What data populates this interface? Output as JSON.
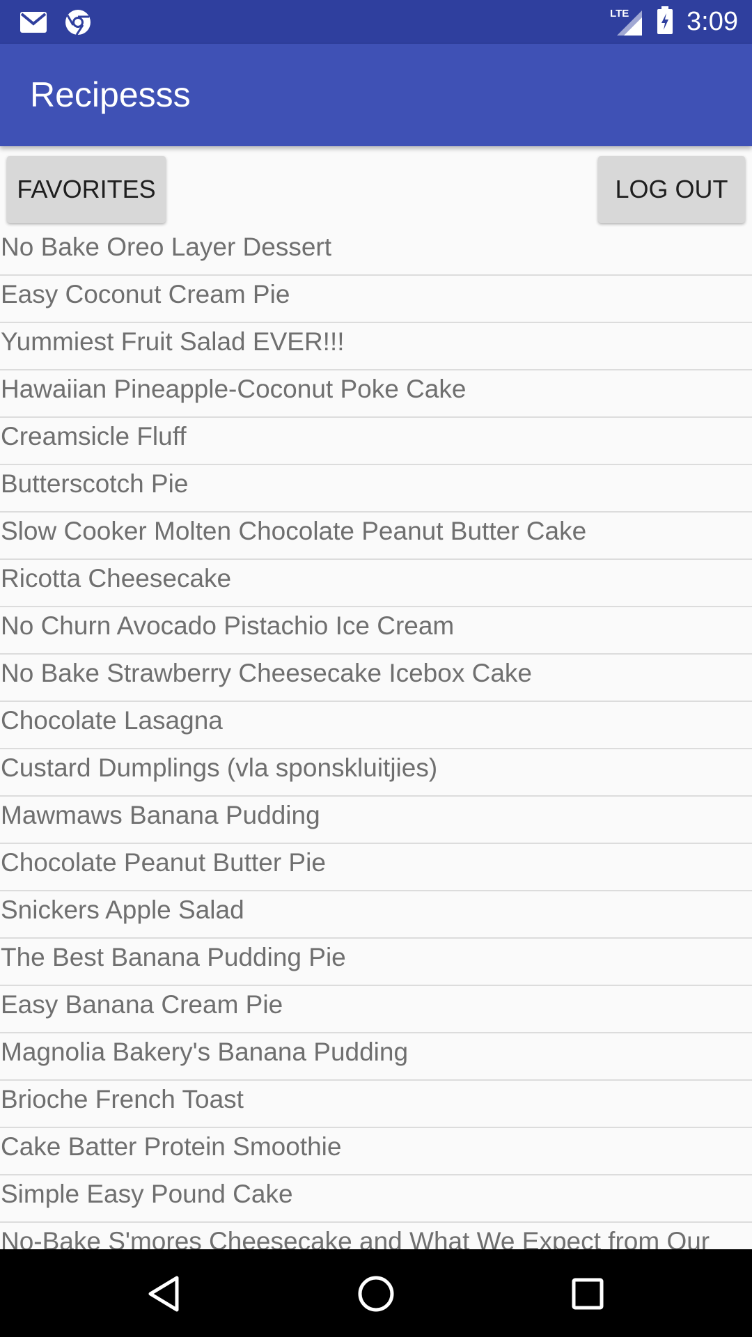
{
  "status_bar": {
    "left_icons": [
      "gmail-icon",
      "chrome-icon"
    ],
    "network_label": "LTE",
    "time": "3:09",
    "colors": {
      "background": "#2f3f9e",
      "foreground": "#ffffff"
    }
  },
  "app_bar": {
    "title": "Recipesss",
    "color": "#3f51b5"
  },
  "actions": {
    "favorites_label": "FAVORITES",
    "logout_label": "LOG OUT"
  },
  "recipes": [
    "No Bake Oreo Layer Dessert",
    "Easy Coconut Cream Pie",
    "Yummiest Fruit Salad EVER!!!",
    "Hawaiian Pineapple-Coconut Poke Cake",
    "Creamsicle Fluff",
    "Butterscotch Pie",
    "Slow Cooker Molten Chocolate Peanut Butter Cake",
    "Ricotta Cheesecake",
    "No Churn Avocado Pistachio Ice Cream",
    "No Bake Strawberry Cheesecake Icebox Cake",
    "Chocolate Lasagna",
    "Custard Dumplings (vla sponskluitjies)",
    "Mawmaws Banana Pudding",
    "Chocolate Peanut Butter Pie",
    "Snickers Apple Salad",
    "The Best Banana Pudding Pie",
    "Easy Banana Cream Pie",
    "Magnolia Bakery's Banana Pudding",
    "Brioche French Toast",
    "Cake Batter Protein Smoothie",
    "Simple Easy Pound Cake",
    "No-Bake S'mores Cheesecake and What We Expect from Our Children"
  ],
  "nav_bar": {
    "icons": [
      "back-icon",
      "home-icon",
      "recents-icon"
    ]
  }
}
